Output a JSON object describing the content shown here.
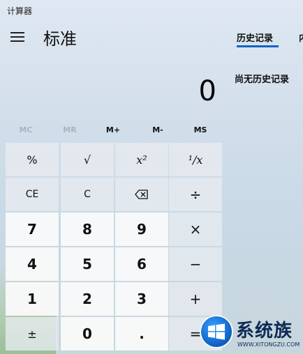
{
  "window": {
    "title": "计算器"
  },
  "header": {
    "menu_icon": "hamburger-menu-icon",
    "mode": "标准"
  },
  "display": {
    "value": "0"
  },
  "memory": [
    {
      "label": "MC",
      "enabled": false
    },
    {
      "label": "MR",
      "enabled": false
    },
    {
      "label": "M+",
      "enabled": true
    },
    {
      "label": "M-",
      "enabled": true
    },
    {
      "label": "MS",
      "enabled": true
    }
  ],
  "keys": {
    "percent": "%",
    "sqrt": "√",
    "square": "x²",
    "reciprocal": "¹/x",
    "clear_entry": "CE",
    "clear": "C",
    "backspace_icon": "backspace-icon",
    "divide": "÷",
    "seven": "7",
    "eight": "8",
    "nine": "9",
    "multiply": "×",
    "four": "4",
    "five": "5",
    "six": "6",
    "subtract": "−",
    "one": "1",
    "two": "2",
    "three": "3",
    "add": "+",
    "negate": "±",
    "zero": "0",
    "decimal": ".",
    "equals": "="
  },
  "sidebar": {
    "history_tab": "历史记录",
    "memory_tab": "内存",
    "history_empty": "尚无历史记录"
  },
  "watermark": {
    "name": "系统族",
    "url": "WWW.XITONGZU.COM"
  },
  "colors": {
    "accent": "#0a64c8",
    "watermark_blue": "#0a5fc4"
  }
}
